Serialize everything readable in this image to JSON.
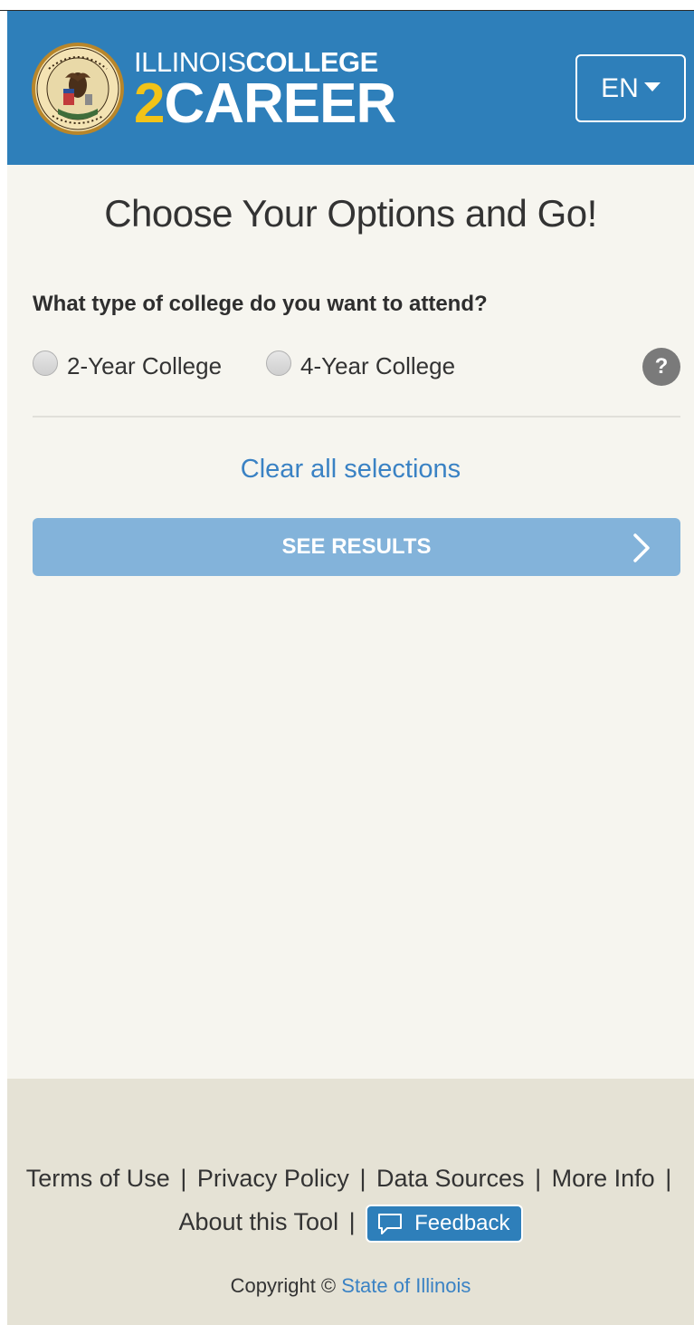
{
  "header": {
    "logo_line1_part1": "ILLINOIS",
    "logo_line1_part2": "COLLEGE",
    "logo_line2_number": "2",
    "logo_line2_word": "CAREER",
    "language_label": "EN",
    "seal_icon": "illinois-state-seal-icon"
  },
  "main": {
    "title": "Choose Your Options and Go!",
    "question": "What type of college do you want to attend?",
    "options": [
      {
        "label": "2-Year College",
        "selected": false
      },
      {
        "label": "4-Year College",
        "selected": false
      }
    ],
    "help_label": "?",
    "clear_label": "Clear all selections",
    "see_results_label": "SEE RESULTS"
  },
  "footer": {
    "links": [
      "Terms of Use",
      "Privacy Policy",
      "Data Sources",
      "More Info",
      "About this Tool"
    ],
    "separator": "|",
    "feedback_label": "Feedback",
    "copyright_prefix": "Copyright ©",
    "copyright_link": "State of Illinois"
  },
  "colors": {
    "header_bg": "#2e7fba",
    "accent_yellow": "#f2c318",
    "page_bg": "#f6f5ef",
    "footer_bg": "#e5e2d5",
    "button_bg": "#83b3da",
    "link": "#3a82c4"
  }
}
